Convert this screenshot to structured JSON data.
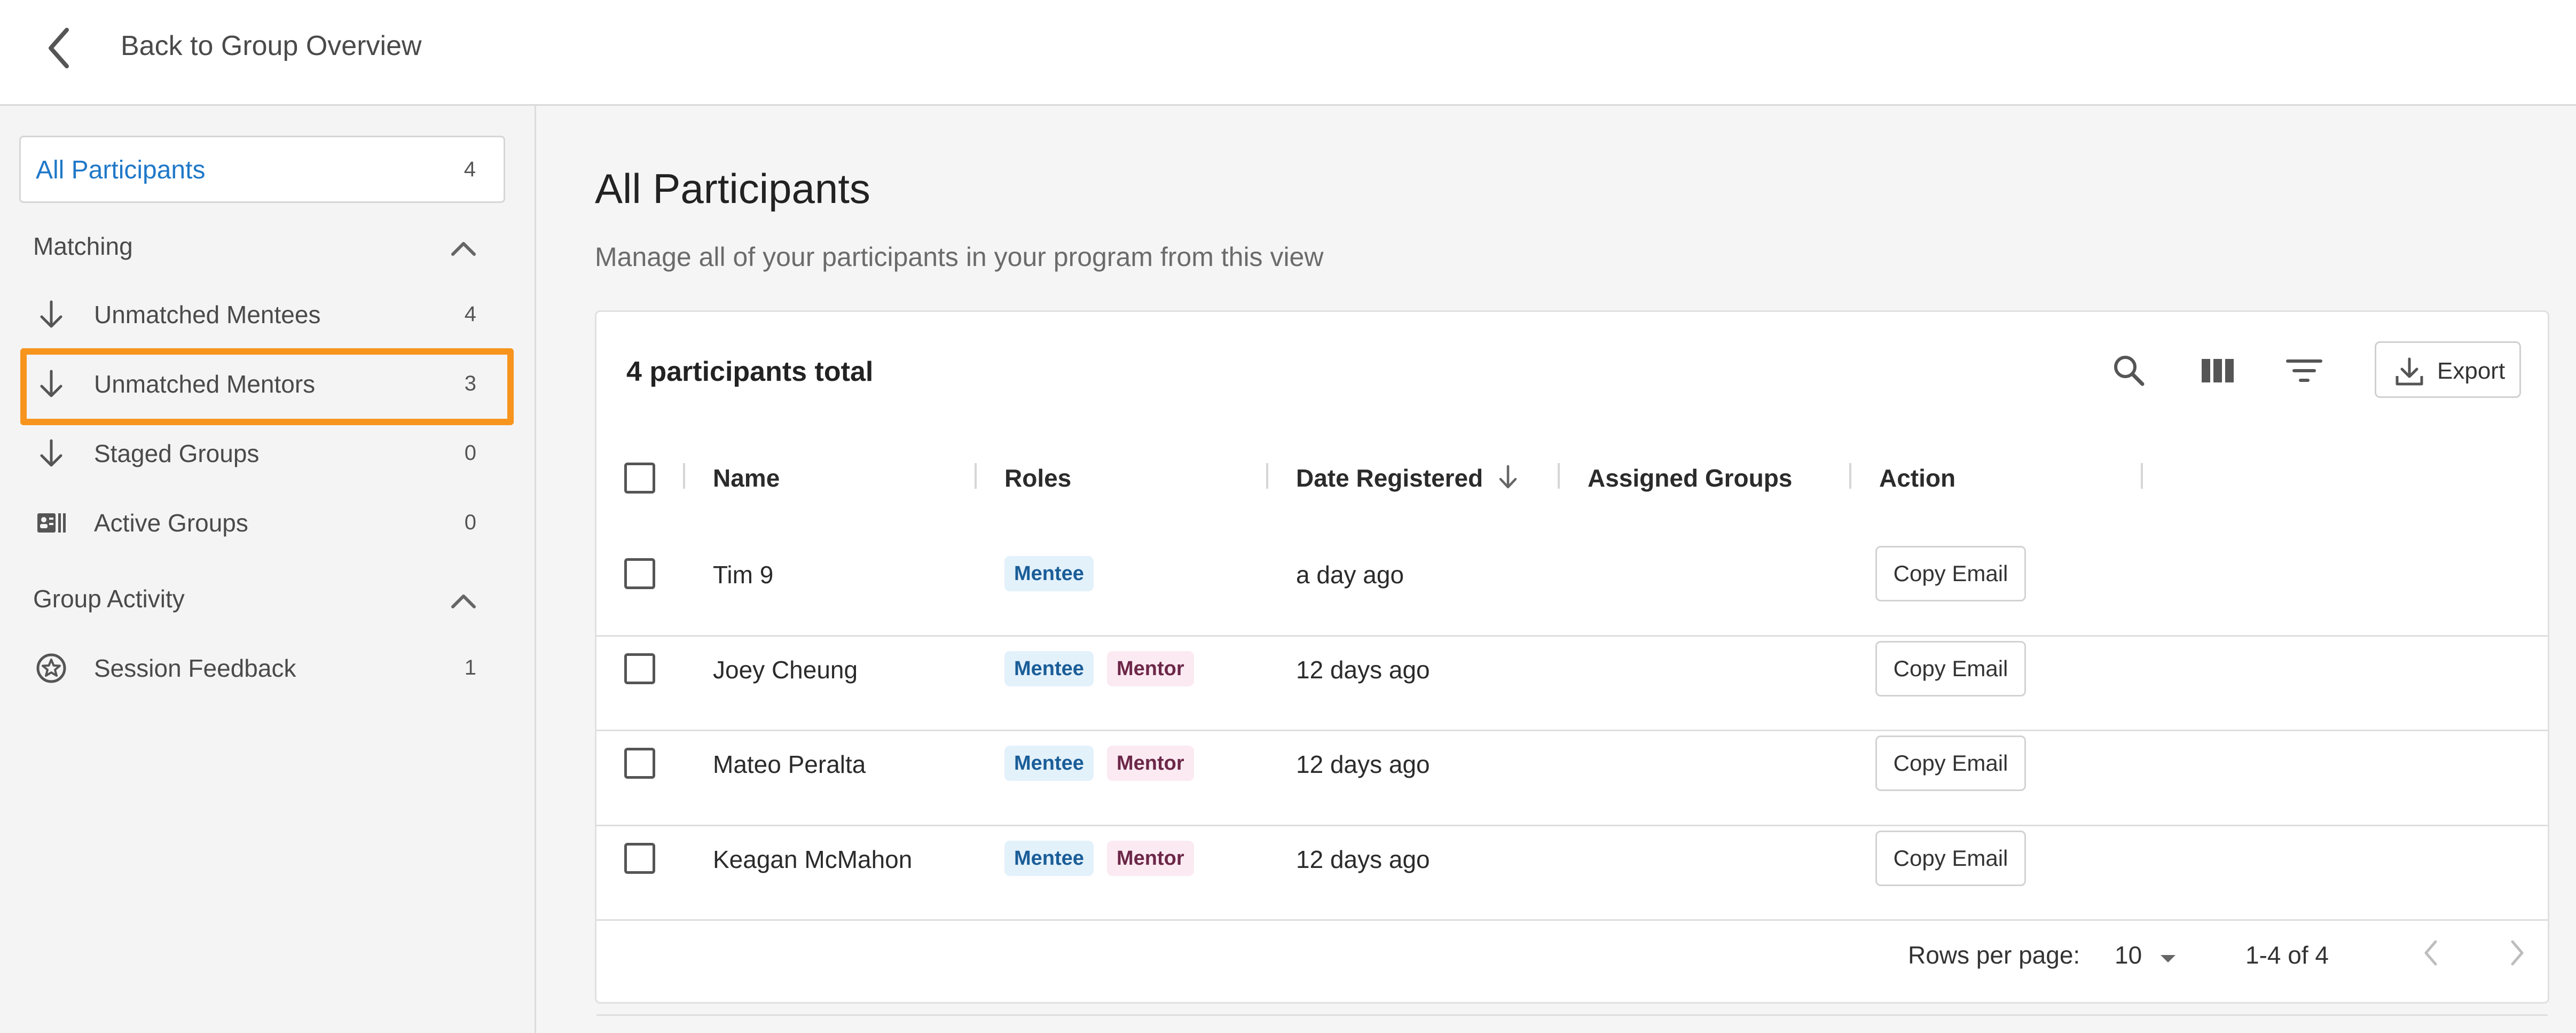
{
  "header": {
    "back_label": "Back to Group Overview"
  },
  "sidebar": {
    "all": {
      "label": "All Participants",
      "count": "4"
    },
    "sections": [
      {
        "title": "Matching",
        "items": [
          {
            "label": "Unmatched Mentees",
            "count": "4",
            "icon": "arrow-down-icon"
          },
          {
            "label": "Unmatched Mentors",
            "count": "3",
            "icon": "arrow-down-icon"
          },
          {
            "label": "Staged Groups",
            "count": "0",
            "icon": "arrow-down-icon"
          },
          {
            "label": "Active Groups",
            "count": "0",
            "icon": "group-card-icon"
          }
        ]
      },
      {
        "title": "Group Activity",
        "items": [
          {
            "label": "Session Feedback",
            "count": "1",
            "icon": "star-badge-icon"
          }
        ]
      }
    ],
    "highlight_color": "#f7941d"
  },
  "main": {
    "title": "All Participants",
    "subtitle": "Manage all of your participants in your program from this view",
    "card": {
      "total": "4 participants total",
      "export_label": "Export",
      "columns": [
        "Name",
        "Roles",
        "Date Registered",
        "Assigned Groups",
        "Action"
      ],
      "rows": [
        {
          "name": "Tim 9",
          "roles": [
            "Mentee"
          ],
          "date": "a day ago",
          "action": "Copy Email"
        },
        {
          "name": "Joey Cheung",
          "roles": [
            "Mentee",
            "Mentor"
          ],
          "date": "12 days ago",
          "action": "Copy Email"
        },
        {
          "name": "Mateo Peralta",
          "roles": [
            "Mentee",
            "Mentor"
          ],
          "date": "12 days ago",
          "action": "Copy Email"
        },
        {
          "name": "Keagan McMahon",
          "roles": [
            "Mentee",
            "Mentor"
          ],
          "date": "12 days ago",
          "action": "Copy Email"
        }
      ],
      "footer": {
        "rows_per_page_label": "Rows per page:",
        "rows_per_page": "10",
        "range": "1-4 of 4"
      }
    }
  },
  "colors": {
    "accent_blue": "#1f78c8",
    "mentee_badge": "#e3f1fb",
    "mentor_badge": "#fbeaf2"
  }
}
